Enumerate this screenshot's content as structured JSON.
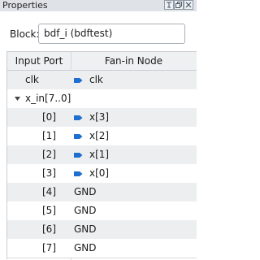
{
  "window": {
    "title": "Properties",
    "buttons": [
      "restore-icon",
      "maximize-icon",
      "close-icon"
    ]
  },
  "block": {
    "label": "Block:",
    "value": "bdf_i (bdftest)"
  },
  "table": {
    "headers": {
      "input_port": "Input Port",
      "fanin_node": "Fan-in Node"
    },
    "rows": [
      {
        "port": "clk",
        "fanin": "clk",
        "pin_icon": true,
        "indent": "top"
      },
      {
        "port": "x_in[7..0]",
        "fanin": "",
        "pin_icon": false,
        "indent": "group",
        "expanded": true
      },
      {
        "port": "[0]",
        "fanin": "x[3]",
        "pin_icon": true,
        "indent": "child"
      },
      {
        "port": "[1]",
        "fanin": "x[2]",
        "pin_icon": true,
        "indent": "child"
      },
      {
        "port": "[2]",
        "fanin": "x[1]",
        "pin_icon": true,
        "indent": "child"
      },
      {
        "port": "[3]",
        "fanin": "x[0]",
        "pin_icon": true,
        "indent": "child"
      },
      {
        "port": "[4]",
        "fanin": "GND",
        "pin_icon": false,
        "indent": "child"
      },
      {
        "port": "[5]",
        "fanin": "GND",
        "pin_icon": false,
        "indent": "child"
      },
      {
        "port": "[6]",
        "fanin": "GND",
        "pin_icon": false,
        "indent": "child"
      },
      {
        "port": "[7]",
        "fanin": "GND",
        "pin_icon": false,
        "indent": "child"
      }
    ]
  },
  "colors": {
    "pin_icon": "#1e6fd0",
    "row_alt": "#eceeef",
    "header_bg": "#eef0f2",
    "titlebar_bg": "#dfe3e8"
  }
}
